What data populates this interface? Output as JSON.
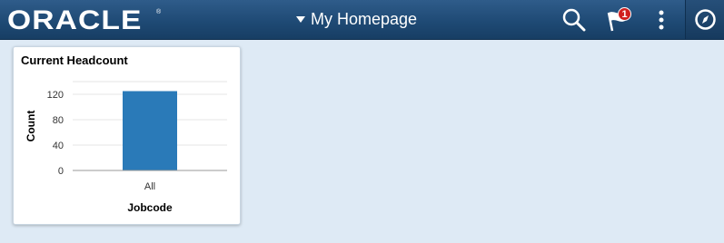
{
  "header": {
    "logo_text": "ORACLE",
    "logo_mark": "®",
    "page_title": "My Homepage",
    "notification_count": "1",
    "icons": [
      "caret-down-icon",
      "search-icon",
      "flag-icon",
      "more-vertical-icon",
      "navigator-icon"
    ]
  },
  "tile": {
    "title": "Current Headcount"
  },
  "chart_data": {
    "type": "bar",
    "categories": [
      "All"
    ],
    "values": [
      125
    ],
    "title": "Current Headcount",
    "xlabel": "Jobcode",
    "ylabel": "Count",
    "ylim": [
      0,
      140
    ],
    "yticks": [
      0,
      40,
      80,
      120
    ],
    "grid": true,
    "colors": {
      "bar": "#2a7ab8"
    }
  },
  "colors": {
    "header": "#1f4a75",
    "background": "#deeaf5",
    "badge": "#d0201f"
  }
}
